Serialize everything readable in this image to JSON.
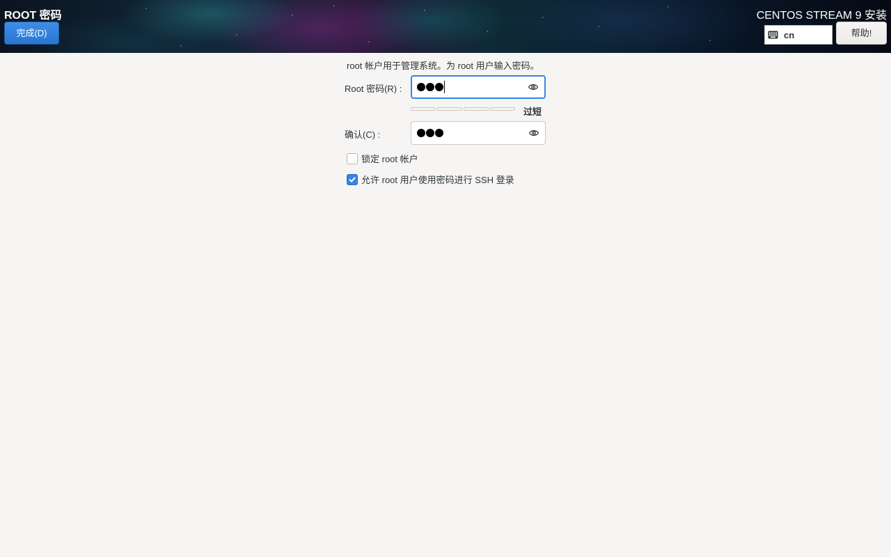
{
  "header": {
    "spoke_title": "ROOT 密码",
    "done_label": "完成(D)",
    "product_title": "CENTOS STREAM 9 安装",
    "keyboard_layout": "cn",
    "help_label": "帮助!"
  },
  "form": {
    "description": "root 帐户用于管理系统。为 root 用户输入密码。",
    "password_label": "Root 密码(R) :",
    "password_dot_count": 3,
    "strength_level": 0,
    "strength_text": "过短",
    "confirm_label": "确认(C) :",
    "confirm_dot_count": 3,
    "lock_root_label": "锁定 root 帐户",
    "lock_root_checked": false,
    "allow_ssh_label": "允许 root 用户使用密码进行 SSH 登录",
    "allow_ssh_checked": true
  },
  "colors": {
    "accent": "#3584e4",
    "background": "#f6f5f4"
  },
  "icons": {
    "keyboard": "keyboard-icon",
    "reveal": "eye-icon",
    "check": "checkmark-icon"
  }
}
